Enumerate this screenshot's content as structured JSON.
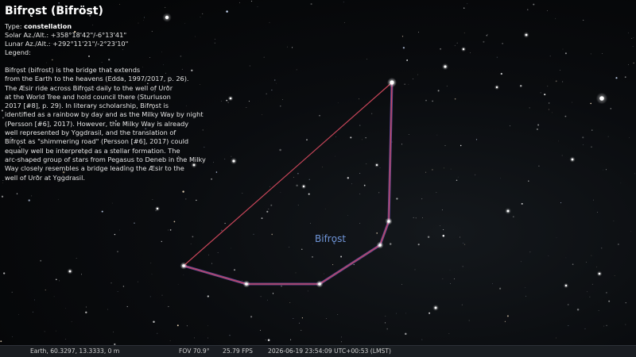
{
  "info": {
    "title": "Bifrǫst (Bifröst)",
    "type_label": "Type: ",
    "type_value": "constellation",
    "solar": "Solar Az./Alt.: +358°18'42\"/-6°13'41\"",
    "lunar": "Lunar Az./Alt.: +292°11'21\"/-2°23'10\"",
    "legend": "Legend:",
    "description": "Bifrǫst (bifrost) is the bridge that extends\nfrom the Earth to the heavens (Edda, 1997/2017, p. 26).\nThe Æsir ride across Bifrǫst daily to the well of Urðr\nat the World Tree and hold council there (Sturluson\n2017 [#8], p. 29). In literary scholarship, Bifrǫst is\nidentified as a rainbow by day and as the Milky Way by night\n(Persson [#6], 2017). However, the Milky Way is already\nwell represented by Yggdrasil, and the translation of\nBifrǫst as \"shimmering road\" (Persson [#6], 2017) could\nequally well be interpreted as a stellar formation. The\narc-shaped group of stars from Pegasus to Deneb in the Milky\nWay closely resembles a bridge leading the Æsir to the\nwell of Urðr at Yggdrasil."
  },
  "constellation": {
    "label": "Bifrǫst",
    "line_color": "#c9465a",
    "highlight_color": "#7d5bc4",
    "label_color": "#6f95d8"
  },
  "status": {
    "location": "Earth, 60.3297, 13.3333, 0 m",
    "fov": "FOV 70.9°",
    "fps": "25.79 FPS",
    "datetime": "2026-06-19 23:54:09 UTC+00:53 (LMST)"
  }
}
